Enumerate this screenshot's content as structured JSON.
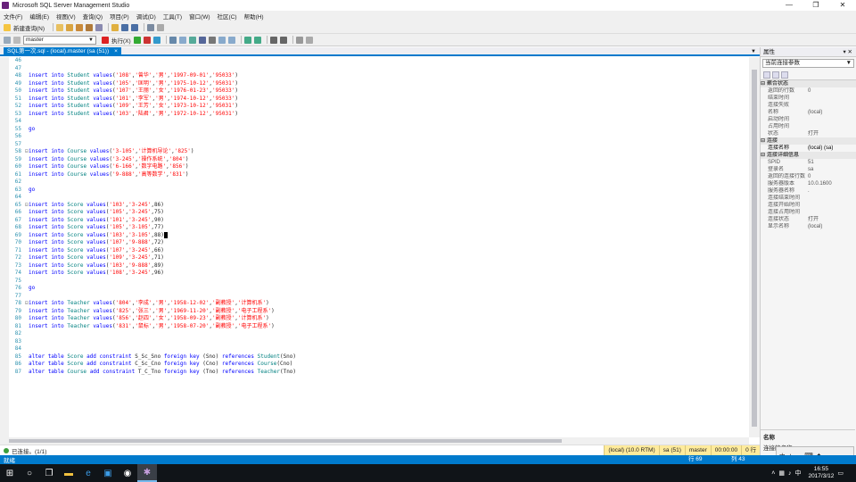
{
  "window": {
    "title": "Microsoft SQL Server Management Studio",
    "buttons": [
      "—",
      "❐",
      "✕"
    ]
  },
  "menu": [
    "文件(F)",
    "编辑(E)",
    "视图(V)",
    "查询(Q)",
    "项目(P)",
    "调试(D)",
    "工具(T)",
    "窗口(W)",
    "社区(C)",
    "帮助(H)"
  ],
  "toolbar": {
    "new_query": "新建查询(N)",
    "database": "master",
    "execute": "执行(X)"
  },
  "tab": {
    "label": "SQL第一次.sql - (local).master (sa (51))",
    "close": "×"
  },
  "code": [
    {
      "n": "46",
      "t": ""
    },
    {
      "n": "47",
      "t": ""
    },
    {
      "n": "48",
      "t": "insert into Student values('108','曾华','男','1997-09-01','95033')"
    },
    {
      "n": "49",
      "t": "insert into Student values('105','匡明','男','1975-10-12','95031')"
    },
    {
      "n": "50",
      "t": "insert into Student values('107','王丽','女','1976-01-23','95033')"
    },
    {
      "n": "51",
      "t": "insert into Student values('101','李军','男','1974-10-12','95033')"
    },
    {
      "n": "52",
      "t": "insert into Student values('109','王芳','女','1973-10-12','95031')"
    },
    {
      "n": "53",
      "t": "insert into Student values('103','陆君','男','1972-10-12','95031')"
    },
    {
      "n": "54",
      "t": ""
    },
    {
      "n": "55",
      "t": "go"
    },
    {
      "n": "56",
      "t": ""
    },
    {
      "n": "57",
      "t": ""
    },
    {
      "n": "58",
      "t": "insert into Course values('3-105','计算机导论','825')",
      "fold": true
    },
    {
      "n": "59",
      "t": "insert into Course values('3-245','操作系统','804')"
    },
    {
      "n": "60",
      "t": "insert into Course values('6-166','数字电路','856')"
    },
    {
      "n": "61",
      "t": "insert into Course values('9-888','高等数学','831')"
    },
    {
      "n": "62",
      "t": ""
    },
    {
      "n": "63",
      "t": "go"
    },
    {
      "n": "64",
      "t": ""
    },
    {
      "n": "65",
      "t": "insert into Score values('103','3-245',86)",
      "fold": true
    },
    {
      "n": "66",
      "t": "insert into Score values('105','3-245',75)"
    },
    {
      "n": "67",
      "t": "insert into Score values('101','3-245',90)"
    },
    {
      "n": "68",
      "t": "insert into Score values('105','3-105',77)"
    },
    {
      "n": "69",
      "t": "insert into Score values('103','3-105',88)",
      "caret": true
    },
    {
      "n": "70",
      "t": "insert into Score values('107','9-888',72)"
    },
    {
      "n": "71",
      "t": "insert into Score values('107','3-245',66)"
    },
    {
      "n": "72",
      "t": "insert into Score values('109','3-245',71)"
    },
    {
      "n": "73",
      "t": "insert into Score values('103','9-888',89)"
    },
    {
      "n": "74",
      "t": "insert into Score values('108','3-245',96)"
    },
    {
      "n": "75",
      "t": ""
    },
    {
      "n": "76",
      "t": "go"
    },
    {
      "n": "77",
      "t": ""
    },
    {
      "n": "78",
      "t": "insert into Teacher values('804','李成','男','1958-12-02','副教授','计算机系')",
      "fold": true
    },
    {
      "n": "79",
      "t": "insert into Teacher values('825','张三','男','1969-11-20','副教授','电子工程系')"
    },
    {
      "n": "80",
      "t": "insert into Teacher values('856','赵四','女','1958-09-23','副教授','计算机系')"
    },
    {
      "n": "81",
      "t": "insert into Teacher values('831','鼠标','男','1958-07-20','副教授','电子工程系')"
    },
    {
      "n": "82",
      "t": ""
    },
    {
      "n": "83",
      "t": ""
    },
    {
      "n": "84",
      "t": ""
    },
    {
      "n": "85",
      "t": "alter table Score add constraint S_Sc_Sno foreign key (Sno) references Student(Sno)"
    },
    {
      "n": "86",
      "t": "alter table Score add constraint C_Sc_Cno foreign key (Cno) references Course(Cno)"
    },
    {
      "n": "87",
      "t": "alter table Course add constraint T_C_Tno foreign key (Tno) references Teacher(Tno)"
    }
  ],
  "query_status": {
    "message": "已连接。(1/1)",
    "server": "(local) (10.0 RTM)",
    "user": "sa (51)",
    "database": "master",
    "time": "00:00:00",
    "rows": "0 行"
  },
  "properties": {
    "title": "属性",
    "pin": "▾ ✕",
    "selector": "当前连接参数",
    "rows": [
      {
        "cat": true,
        "k": "聚合状态"
      },
      {
        "k": "返回的行数",
        "v": "0"
      },
      {
        "k": "结束时间",
        "v": ""
      },
      {
        "k": "连接失败",
        "v": ""
      },
      {
        "k": "名称",
        "v": "(local)"
      },
      {
        "k": "启动时间",
        "v": ""
      },
      {
        "k": "占用时间",
        "v": ""
      },
      {
        "k": "状态",
        "v": "打开"
      },
      {
        "cat": true,
        "k": "连接"
      },
      {
        "k": "连接名称",
        "v": "(local) (sa)",
        "strong": true
      },
      {
        "cat": true,
        "k": "连接详细信息"
      },
      {
        "k": "SPID",
        "v": "51"
      },
      {
        "k": "登录名",
        "v": "sa"
      },
      {
        "k": "返回的连接行数",
        "v": "0"
      },
      {
        "k": "服务器版本",
        "v": "10.0.1600"
      },
      {
        "k": "服务器名称",
        "v": "."
      },
      {
        "k": "连接结束时间",
        "v": ""
      },
      {
        "k": "连接开始时间",
        "v": ""
      },
      {
        "k": "连接占用时间",
        "v": ""
      },
      {
        "k": "连接状态",
        "v": "打开"
      },
      {
        "k": "显示名称",
        "v": "(local)"
      }
    ],
    "desc_title": "名称",
    "desc_text": "连接的名称。"
  },
  "statusbar": {
    "ready": "就绪",
    "row": "行 69",
    "col": "列 43",
    "ch": "Ch 43",
    "mode": "Ins"
  },
  "ime": [
    "中",
    "♪",
    "，",
    "⌨",
    "✦"
  ],
  "taskbar": {
    "time": "16:55",
    "date": "2017/3/12"
  },
  "colors": {
    "accent": "#007acc",
    "keyword": "#0000ff",
    "identifier": "#008080",
    "string": "#ff0000"
  }
}
